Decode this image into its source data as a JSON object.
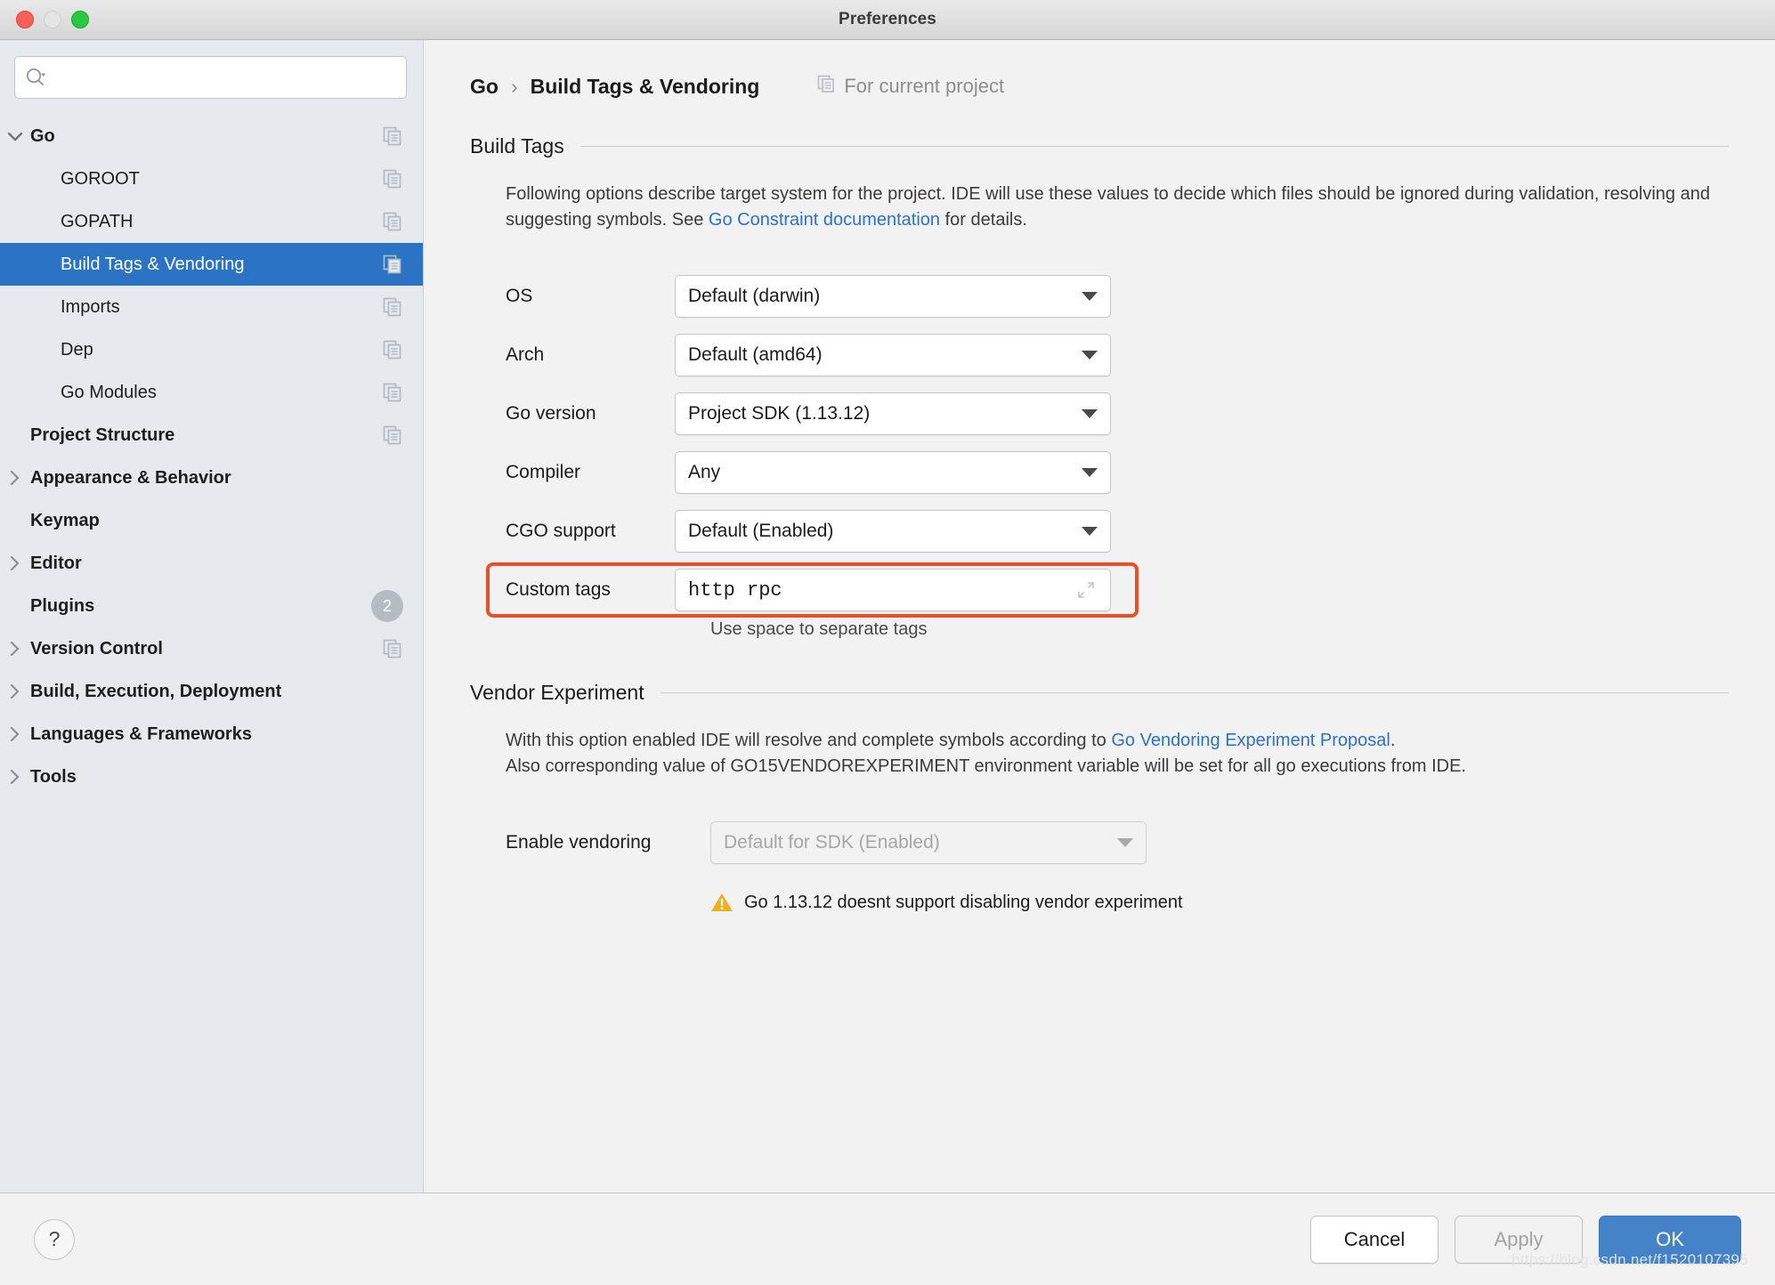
{
  "window": {
    "title": "Preferences",
    "traffic_lights": [
      "close-button",
      "minimize-button",
      "zoom-button"
    ]
  },
  "sidebar": {
    "search": {
      "value": "",
      "placeholder": ""
    },
    "items": [
      {
        "label": "Go",
        "level": 0,
        "bold": true,
        "twisty": "down",
        "copy_icon": true,
        "selected": false
      },
      {
        "label": "GOROOT",
        "level": 1,
        "bold": false,
        "twisty": "none",
        "copy_icon": true,
        "selected": false
      },
      {
        "label": "GOPATH",
        "level": 1,
        "bold": false,
        "twisty": "none",
        "copy_icon": true,
        "selected": false
      },
      {
        "label": "Build Tags & Vendoring",
        "level": 1,
        "bold": false,
        "twisty": "none",
        "copy_icon": true,
        "selected": true
      },
      {
        "label": "Imports",
        "level": 1,
        "bold": false,
        "twisty": "none",
        "copy_icon": true,
        "selected": false
      },
      {
        "label": "Dep",
        "level": 1,
        "bold": false,
        "twisty": "none",
        "copy_icon": true,
        "selected": false
      },
      {
        "label": "Go Modules",
        "level": 1,
        "bold": false,
        "twisty": "none",
        "copy_icon": true,
        "selected": false
      },
      {
        "label": "Project Structure",
        "level": 0,
        "bold": true,
        "twisty": "none",
        "copy_icon": true,
        "selected": false
      },
      {
        "label": "Appearance & Behavior",
        "level": 0,
        "bold": true,
        "twisty": "right",
        "copy_icon": false,
        "selected": false
      },
      {
        "label": "Keymap",
        "level": 0,
        "bold": true,
        "twisty": "none",
        "copy_icon": false,
        "selected": false
      },
      {
        "label": "Editor",
        "level": 0,
        "bold": true,
        "twisty": "right",
        "copy_icon": false,
        "selected": false
      },
      {
        "label": "Plugins",
        "level": 0,
        "bold": true,
        "twisty": "none",
        "copy_icon": false,
        "badge": "2",
        "selected": false
      },
      {
        "label": "Version Control",
        "level": 0,
        "bold": true,
        "twisty": "right",
        "copy_icon": true,
        "selected": false
      },
      {
        "label": "Build, Execution, Deployment",
        "level": 0,
        "bold": true,
        "twisty": "right",
        "copy_icon": false,
        "selected": false
      },
      {
        "label": "Languages & Frameworks",
        "level": 0,
        "bold": true,
        "twisty": "right",
        "copy_icon": false,
        "selected": false
      },
      {
        "label": "Tools",
        "level": 0,
        "bold": true,
        "twisty": "right",
        "copy_icon": false,
        "selected": false
      }
    ]
  },
  "header": {
    "crumb_root": "Go",
    "crumb_sep": "›",
    "crumb_current": "Build Tags & Vendoring",
    "for_current_project": "For current project"
  },
  "build_tags": {
    "section_title": "Build Tags",
    "desc_part1": "Following options describe target system for the project. IDE will use these values to decide which files should be ignored during validation, resolving and suggesting symbols. See ",
    "desc_link": "Go Constraint documentation",
    "desc_part2": " for details.",
    "fields": [
      {
        "label": "OS",
        "value": "Default (darwin)",
        "type": "dropdown"
      },
      {
        "label": "Arch",
        "value": "Default (amd64)",
        "type": "dropdown"
      },
      {
        "label": "Go version",
        "value": "Project SDK (1.13.12)",
        "type": "dropdown"
      },
      {
        "label": "Compiler",
        "value": "Any",
        "type": "dropdown"
      },
      {
        "label": "CGO support",
        "value": "Default (Enabled)",
        "type": "dropdown"
      }
    ],
    "custom_tags": {
      "label": "Custom tags",
      "value": "http rpc",
      "hint": "Use space to separate tags",
      "highlight_color": "#e8502a",
      "expand_icon": "expand-icon"
    }
  },
  "vendor_experiment": {
    "section_title": "Vendor Experiment",
    "desc_line1_part1": "With this option enabled IDE will resolve and complete symbols according to ",
    "desc_line1_link": "Go Vendoring Experiment Proposal",
    "desc_line1_part2": ".",
    "desc_line2": "Also corresponding value of GO15VENDOREXPERIMENT environment variable will be set for all go executions from IDE.",
    "enable_vendoring": {
      "label": "Enable vendoring",
      "value": "Default for SDK (Enabled)",
      "disabled": true
    },
    "warning": "Go 1.13.12 doesnt support disabling vendor experiment"
  },
  "footer": {
    "help_label": "?",
    "cancel_label": "Cancel",
    "apply_label": "Apply",
    "ok_label": "OK",
    "watermark": "https://blog.csdn.net/f1520107395"
  },
  "colors": {
    "selection_blue": "#2b73c4",
    "link_blue": "#2b72c9",
    "primary_button": "#4483c8",
    "highlight_red": "#e8502a",
    "warning_amber": "#f0ad1e"
  }
}
